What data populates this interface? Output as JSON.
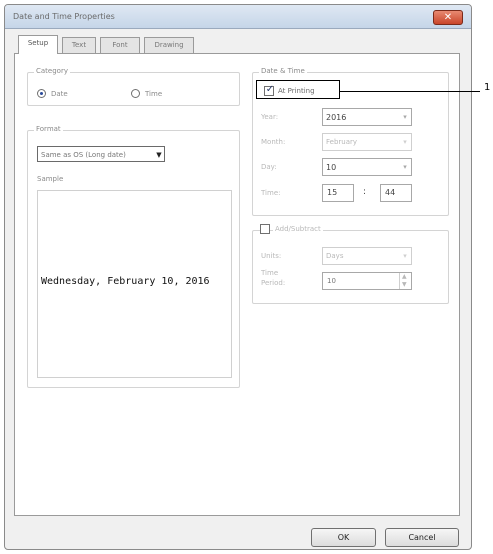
{
  "window": {
    "title": "Date and Time Properties",
    "close_icon": "close-icon"
  },
  "tabs": [
    {
      "label": "Setup",
      "active": true
    },
    {
      "label": "Text"
    },
    {
      "label": "Font"
    },
    {
      "label": "Drawing"
    }
  ],
  "category": {
    "legend": "Category",
    "options": [
      {
        "label": "Date",
        "selected": true
      },
      {
        "label": "Time",
        "selected": false
      }
    ]
  },
  "format": {
    "legend": "Format",
    "selected": "Same as OS (Long date)"
  },
  "sample": {
    "label": "Sample",
    "text": "Wednesday, February 10, 2016"
  },
  "date_time": {
    "legend": "Date & Time",
    "at_printing": {
      "label": "At Printing",
      "checked": true
    },
    "year": {
      "label": "Year:",
      "value": "2016"
    },
    "month": {
      "label": "Month:",
      "value": "February"
    },
    "day": {
      "label": "Day:",
      "value": "10"
    },
    "time": {
      "label": "Time:",
      "hour": "15",
      "separator": ":",
      "minute": "44"
    }
  },
  "add_subtract": {
    "label": "Add/Subtract",
    "checked": false,
    "units": {
      "label": "Units:",
      "value": "Days"
    },
    "time_period": {
      "label": "Time Period:",
      "label_line1": "Time",
      "label_line2": "Period:",
      "value": "10"
    }
  },
  "buttons": {
    "ok": "OK",
    "cancel": "Cancel"
  },
  "callout": {
    "number": "1"
  },
  "colors": {
    "title_bar": "#c5d5e8",
    "close_button": "#c9452a",
    "check_mark": "#2a3a6a"
  }
}
